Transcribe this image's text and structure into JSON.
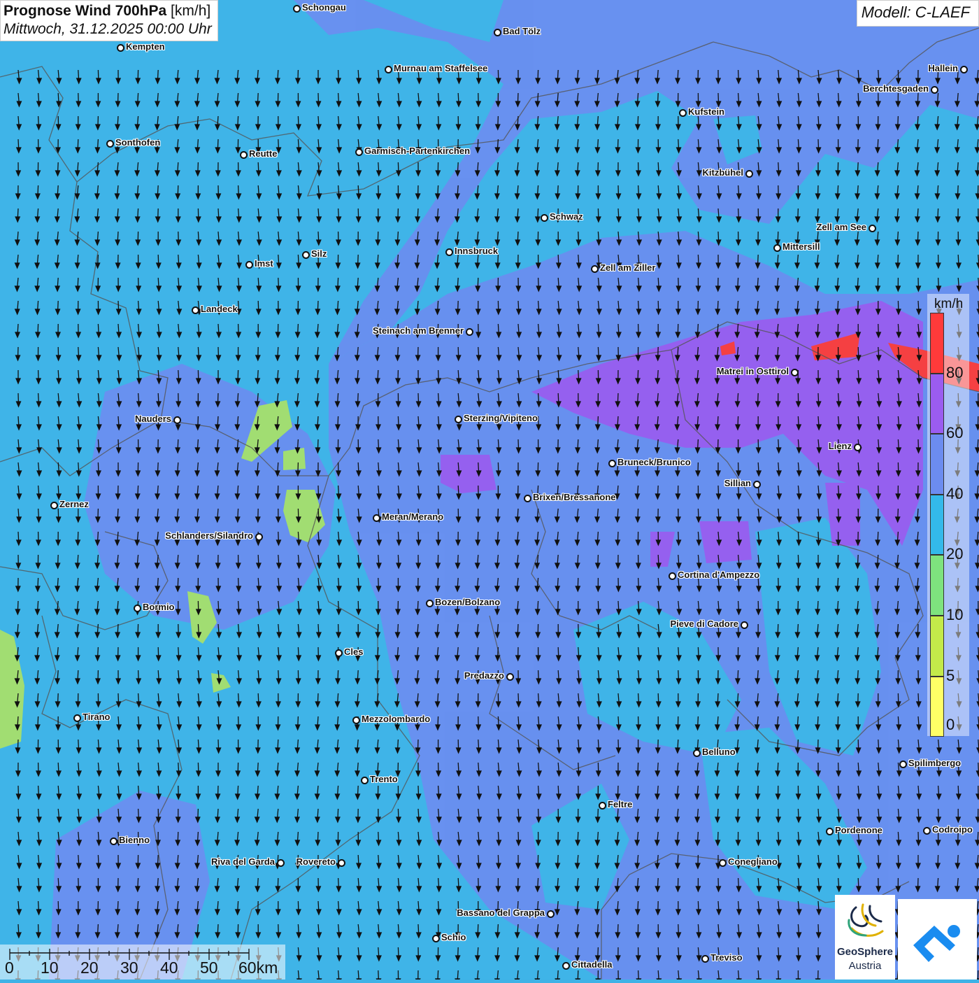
{
  "title": {
    "main": "Prognose Wind 700hPa",
    "unit": "[km/h]",
    "datetime": "Mittwoch, 31.12.2025 00:00 Uhr"
  },
  "model": "Modell: C-LAEF",
  "legend": {
    "unit": "km/h",
    "bands": [
      {
        "label": "",
        "color": "#ff3a3a"
      },
      {
        "label": "80",
        "color": "#9b5cf0"
      },
      {
        "label": "60",
        "color": "#6c8cf0"
      },
      {
        "label": "40",
        "color": "#33b9ea"
      },
      {
        "label": "20",
        "color": "#7ee37e"
      },
      {
        "label": "10",
        "color": "#c3ea4a"
      },
      {
        "label": "5",
        "color": "#ffff66"
      }
    ],
    "bottom_label": "0"
  },
  "scale": {
    "labels": [
      "0",
      "10",
      "20",
      "30",
      "40",
      "50",
      "60km"
    ]
  },
  "logos": {
    "geosphere_line1": "GeoSphere",
    "geosphere_line2": "Austria"
  },
  "cities": [
    {
      "name": "Schongau"
    },
    {
      "name": "Bad Tölz"
    },
    {
      "name": "Kempten"
    },
    {
      "name": "Murnau am Staffelsee"
    },
    {
      "name": "Hallein"
    },
    {
      "name": "Berchtesgaden"
    },
    {
      "name": "Kufstein"
    },
    {
      "name": "Sonthofen"
    },
    {
      "name": "Reutte"
    },
    {
      "name": "Garmisch-Partenkirchen"
    },
    {
      "name": "Kitzbühel"
    },
    {
      "name": "Schwaz"
    },
    {
      "name": "Zell am See"
    },
    {
      "name": "Mittersill"
    },
    {
      "name": "Innsbruck"
    },
    {
      "name": "Silz"
    },
    {
      "name": "Imst"
    },
    {
      "name": "Zell am Ziller"
    },
    {
      "name": "Landeck"
    },
    {
      "name": "Steinach am Brenner"
    },
    {
      "name": "Matrei in Osttirol"
    },
    {
      "name": "Nauders"
    },
    {
      "name": "Sterzing/Vipiteno"
    },
    {
      "name": "Lienz"
    },
    {
      "name": "Bruneck/Brunico"
    },
    {
      "name": "Sillian"
    },
    {
      "name": "Brixen/Bressanone"
    },
    {
      "name": "Zernez"
    },
    {
      "name": "Meran/Merano"
    },
    {
      "name": "Schlanders/Silandro"
    },
    {
      "name": "Cortina d'Ampezzo"
    },
    {
      "name": "Bozen/Bolzano"
    },
    {
      "name": "Bormio"
    },
    {
      "name": "Pieve di Cadore"
    },
    {
      "name": "Cles"
    },
    {
      "name": "Predazzo"
    },
    {
      "name": "Tirano"
    },
    {
      "name": "Mezzolombardo"
    },
    {
      "name": "Belluno"
    },
    {
      "name": "Spilimbergo"
    },
    {
      "name": "Trento"
    },
    {
      "name": "Feltre"
    },
    {
      "name": "Bienno"
    },
    {
      "name": "Pordenone"
    },
    {
      "name": "Codroipo"
    },
    {
      "name": "Riva del Garda"
    },
    {
      "name": "Rovereto"
    },
    {
      "name": "Conegliano"
    },
    {
      "name": "Bassano del Grappa"
    },
    {
      "name": "Schio"
    },
    {
      "name": "Treviso"
    },
    {
      "name": "Cittadella"
    }
  ]
}
